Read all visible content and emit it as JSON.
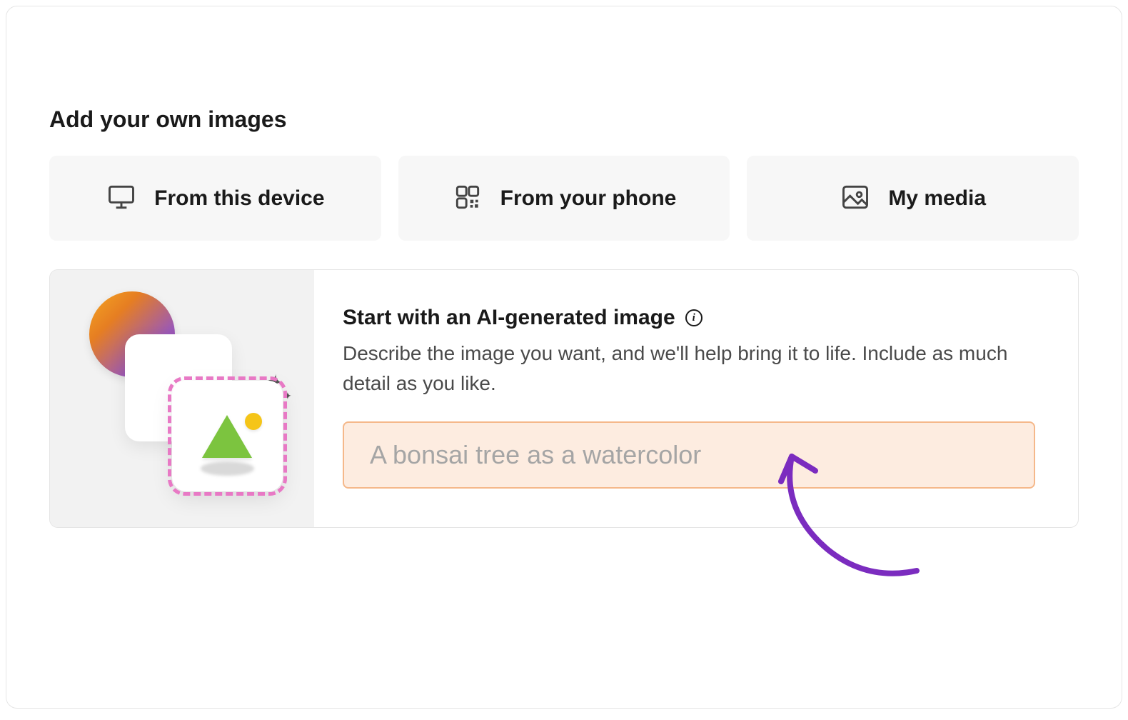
{
  "section_title": "Add your own images",
  "sources": [
    {
      "label": "From this device",
      "icon": "monitor"
    },
    {
      "label": "From your phone",
      "icon": "qr"
    },
    {
      "label": "My media",
      "icon": "image"
    }
  ],
  "ai_card": {
    "title": "Start with an AI-generated image",
    "description": "Describe the image you want, and we'll help bring it to life. Include as much detail as you like.",
    "placeholder": "A bonsai tree as a watercolor"
  },
  "colors": {
    "input_bg": "#fdece0",
    "input_border": "#f5b88a",
    "annotation": "#7b2cbf"
  }
}
